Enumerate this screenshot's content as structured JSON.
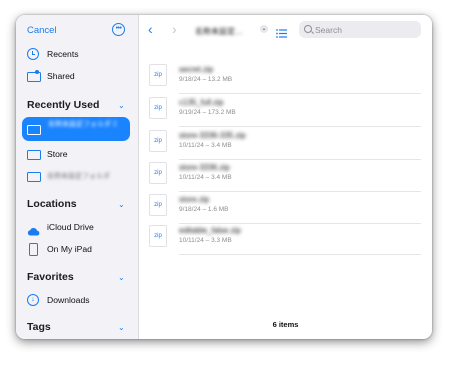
{
  "sidebar": {
    "cancel_label": "Cancel",
    "more_icon": "ellipsis-circle-icon",
    "top_items": [
      {
        "label": "Recents",
        "icon": "clock-icon"
      },
      {
        "label": "Shared",
        "icon": "shared-folder-icon"
      }
    ],
    "recently_used": {
      "header": "Recently Used",
      "items": [
        {
          "label": "名称未設定フォルダ 2",
          "selected": true,
          "icon": "folder-icon"
        },
        {
          "label": "Store",
          "selected": false,
          "icon": "folder-icon"
        },
        {
          "label": "名称未設定フォルダ",
          "selected": false,
          "icon": "folder-icon"
        }
      ]
    },
    "locations": {
      "header": "Locations",
      "items": [
        {
          "label": "iCloud Drive",
          "icon": "cloud-icon"
        },
        {
          "label": "On My iPad",
          "icon": "ipad-icon"
        }
      ]
    },
    "favorites": {
      "header": "Favorites",
      "items": [
        {
          "label": "Downloads",
          "icon": "download-circle-icon"
        }
      ]
    },
    "tags": {
      "header": "Tags"
    }
  },
  "toolbar": {
    "title": "名称未設定…",
    "search_placeholder": "Search",
    "colors": {
      "accent": "#1a7cf2",
      "selected_bg": "#1a84ff"
    }
  },
  "files": [
    {
      "icon_label": "zip",
      "name": "secret.zip",
      "date": "9/18/24",
      "size": "13.2 MB"
    },
    {
      "icon_label": "zip",
      "name": "c135_full.zip",
      "date": "9/19/24",
      "size": "173.2 MB"
    },
    {
      "icon_label": "zip",
      "name": "store-3336-335.zip",
      "date": "10/11/24",
      "size": "3.4 MB"
    },
    {
      "icon_label": "zip",
      "name": "store-3336.zip",
      "date": "10/11/24",
      "size": "3.4 MB"
    },
    {
      "icon_label": "zip",
      "name": "store.zip",
      "date": "9/18/24",
      "size": "1.6 MB"
    },
    {
      "icon_label": "zip",
      "name": "editable_false.zip",
      "date": "10/11/24",
      "size": "3.3 MB"
    }
  ],
  "footer": {
    "count": "6 items"
  }
}
